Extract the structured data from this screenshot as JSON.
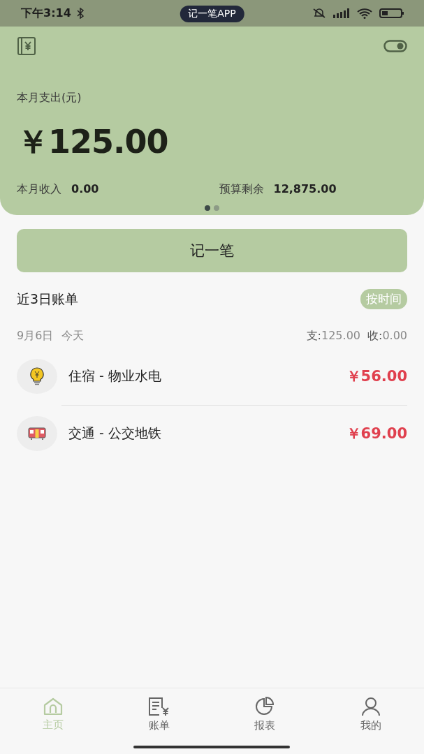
{
  "status_bar": {
    "time": "下午3:14",
    "app_pill": "记一笔APP"
  },
  "header": {
    "expense_label": "本月支出(元)",
    "expense": "￥125.00",
    "income_label": "本月收入",
    "income": "0.00",
    "budget_label": "预算剩余",
    "budget": "12,875.00",
    "pages": [
      {
        "selected": true
      },
      {
        "selected": false
      }
    ]
  },
  "add_button": "记一笔",
  "recent": {
    "title": "近3日账单",
    "sort_button": "按时间",
    "days": [
      {
        "date": "9月6日",
        "day_label": "今天",
        "expense": "**支:**125.00",
        "income": "**收:**0.00",
        "entries": [
          {
            "kind": "utilities",
            "title": "住宿 - 物业水电",
            "amount": "￥56.00"
          },
          {
            "kind": "transit",
            "title": "交通 - 公交地铁",
            "amount": "￥69.00"
          }
        ]
      }
    ]
  },
  "tabs": [
    {
      "kind": "home",
      "label": "主页",
      "selected": true
    },
    {
      "kind": "bills",
      "label": "账单",
      "selected": false
    },
    {
      "kind": "reports",
      "label": "报表",
      "selected": false
    },
    {
      "kind": "profile",
      "label": "我的",
      "selected": false
    }
  ]
}
